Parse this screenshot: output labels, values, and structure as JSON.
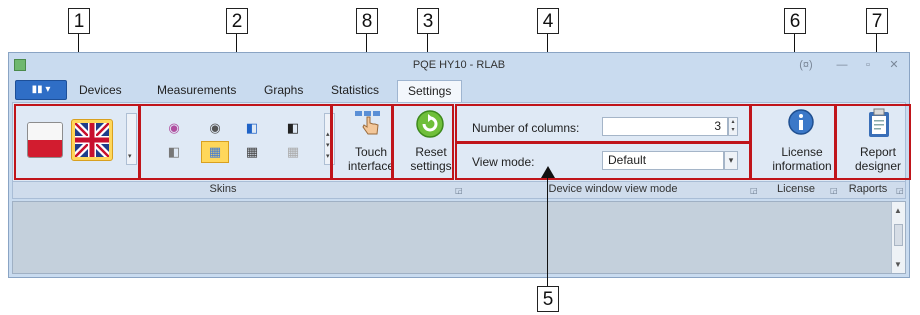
{
  "window": {
    "title": "PQE HY10 - RLAB",
    "restore_glyph": "(¤)",
    "minimize_glyph": "—",
    "maximize_glyph": "▫",
    "close_glyph": "✕"
  },
  "tabs": {
    "file_glyph": "▮▮ ▾",
    "items": [
      {
        "label": "Devices"
      },
      {
        "label": "Measurements"
      },
      {
        "label": "Graphs"
      },
      {
        "label": "Statistics"
      },
      {
        "label": "Settings"
      }
    ]
  },
  "ribbon": {
    "touch": {
      "line1": "Touch",
      "line2": "interface"
    },
    "reset": {
      "line1": "Reset",
      "line2": "settings"
    },
    "columns": {
      "label": "Number of columns:",
      "value": "3"
    },
    "view_mode": {
      "label": "View mode:",
      "value": "Default"
    },
    "license": {
      "line1": "License",
      "line2": "information"
    },
    "report": {
      "line1": "Report",
      "line2": "designer"
    }
  },
  "groups": {
    "skins": "Skins",
    "view": "Device window view mode",
    "license": "License",
    "reports": "Raports"
  },
  "callouts": {
    "c1": "1",
    "c2": "2",
    "c3": "3",
    "c4": "4",
    "c5": "5",
    "c6": "6",
    "c7": "7",
    "c8": "8"
  },
  "colors": {
    "highlight": "#c0141a",
    "accent": "#2f6ec6"
  }
}
